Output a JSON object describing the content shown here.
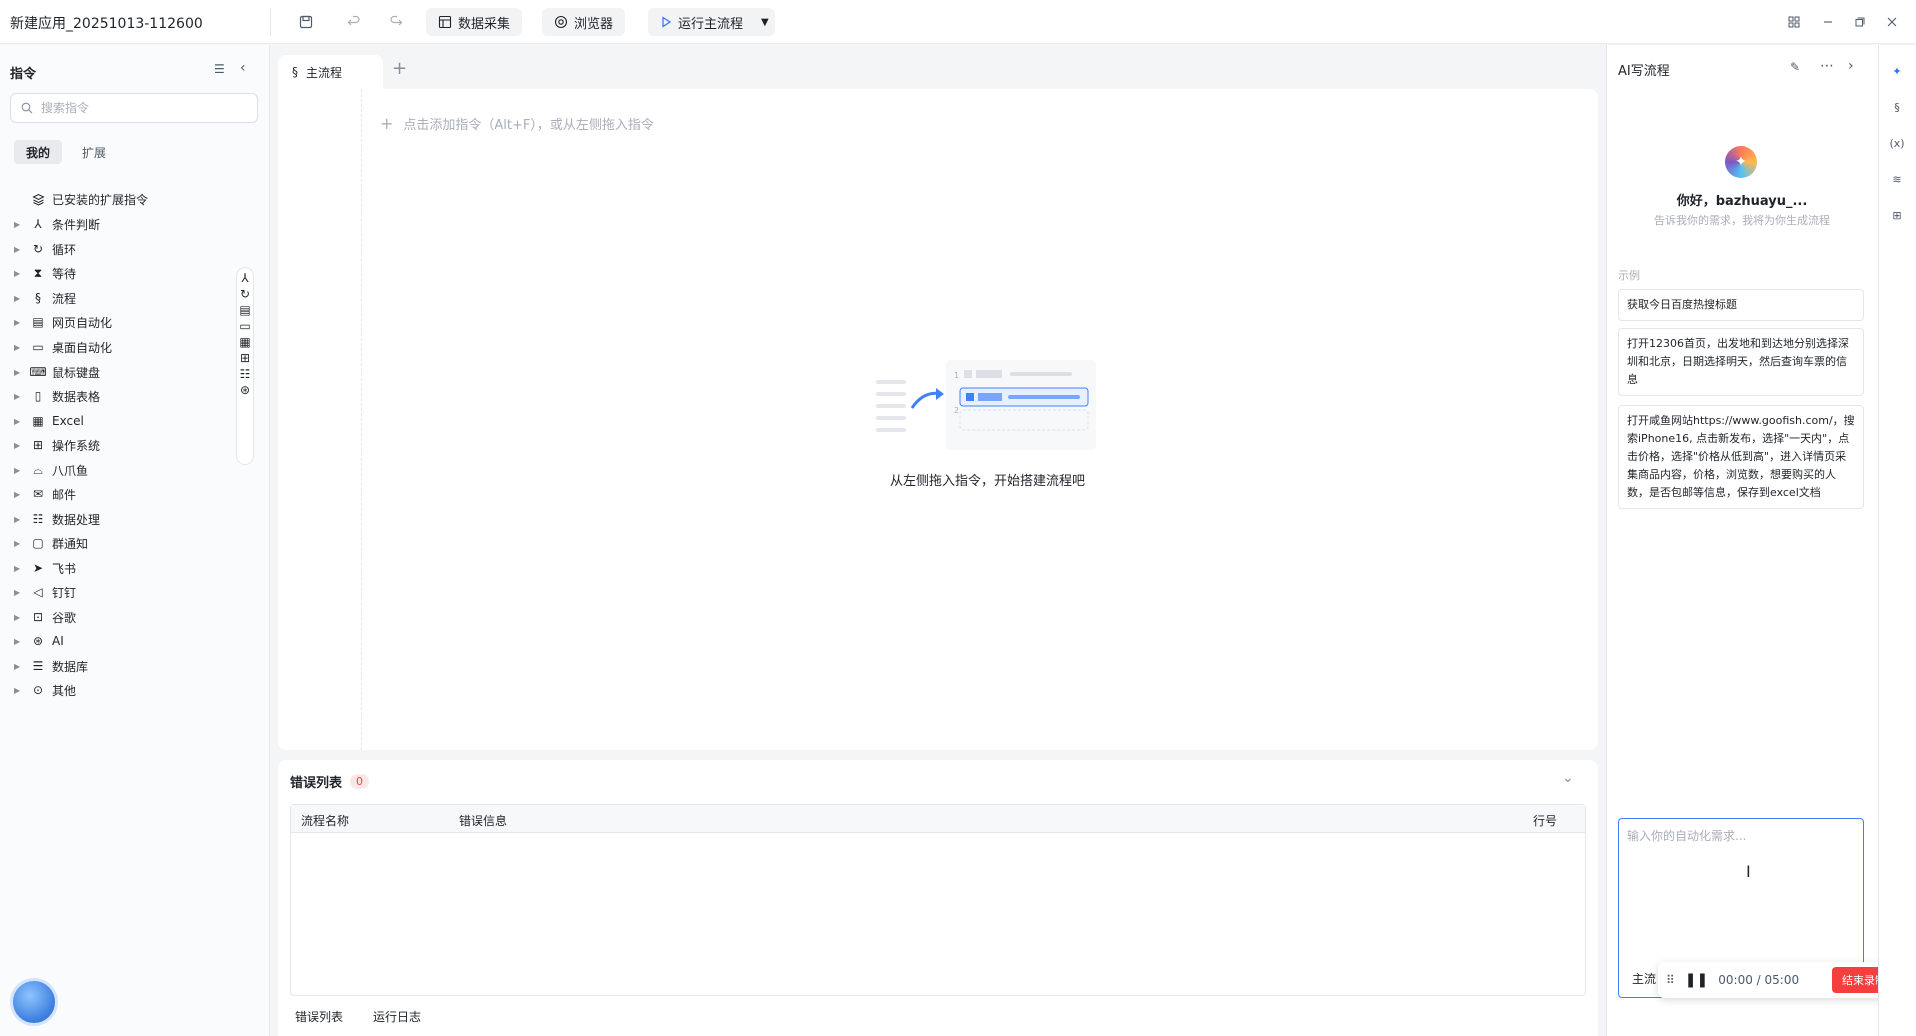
{
  "app": {
    "title": "新建应用_20251013-112600"
  },
  "toolbar": {
    "data_collect_label": "数据采集",
    "browser_label": "浏览器",
    "run_label": "运行主流程"
  },
  "left": {
    "title": "指令",
    "search_placeholder": "搜索指令",
    "tabs": [
      "我的",
      "扩展"
    ],
    "installed_label": "已安装的扩展指令",
    "items": [
      "条件判断",
      "循环",
      "等待",
      "流程",
      "网页自动化",
      "桌面自动化",
      "鼠标键盘",
      "数据表格",
      "Excel",
      "操作系统",
      "八爪鱼",
      "邮件",
      "数据处理",
      "群通知",
      "飞书",
      "钉钉",
      "谷歌",
      "AI",
      "数据库",
      "其他"
    ]
  },
  "main": {
    "tab_label": "主流程",
    "add_hint": "点击添加指令（Alt+F），或从左侧拖入指令",
    "empty_text": "从左侧拖入指令，开始搭建流程吧",
    "empty_art_rows": [
      "1",
      "2"
    ]
  },
  "errors": {
    "title": "错误列表",
    "count": "0",
    "columns": [
      "流程名称",
      "错误信息",
      "行号"
    ],
    "bottom_tabs": [
      "错误列表",
      "运行日志"
    ]
  },
  "ai": {
    "title": "AI写流程",
    "greeting": "你好，bazhuayu_...",
    "subtitle": "告诉我你的需求，我将为你生成流程",
    "examples_label": "示例",
    "examples": [
      "获取今日百度热搜标题",
      "打开12306首页，出发地和到达地分别选择深圳和北京，日期选择明天，然后查询车票的信息",
      "打开咸鱼网站https://www.goofish.com/，搜索iPhone16, 点击新发布，选择\"一天内\"，点击价格，选择\"价格从低到高\"，进入详情页采集商品内容，价格，浏览数，想要购买的人数，是否包邮等信息，保存到excel文档"
    ],
    "input_placeholder": "输入你的自动化需求...",
    "mode_label": "主流",
    "recorder": {
      "time": "00:00 / 05:00",
      "end_label": "结束录制"
    }
  },
  "colors": {
    "accent": "#4080ff",
    "danger": "#f53f3f"
  }
}
